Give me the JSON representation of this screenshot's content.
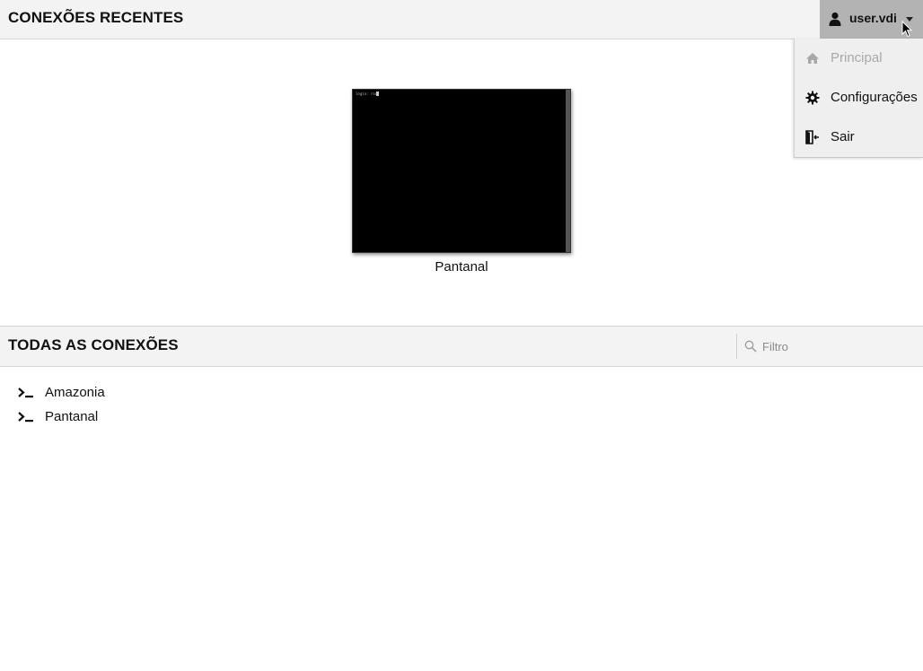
{
  "recent": {
    "title": "CONEXÕES RECENTES",
    "connections": [
      {
        "name": "Pantanal",
        "terminal_text": "login: root"
      }
    ]
  },
  "user_menu": {
    "username": "user.vdi",
    "icon": "user-icon",
    "items": [
      {
        "label": "Principal",
        "icon": "home-icon",
        "disabled": true
      },
      {
        "label": "Configurações",
        "icon": "gear-icon",
        "disabled": false
      },
      {
        "label": "Sair",
        "icon": "logout-icon",
        "disabled": false
      }
    ]
  },
  "all": {
    "title": "TODAS AS CONEXÕES",
    "filter": {
      "placeholder": "Filtro",
      "value": ""
    },
    "connections": [
      {
        "name": "Amazonia",
        "icon": "terminal-prompt-icon"
      },
      {
        "name": "Pantanal",
        "icon": "terminal-prompt-icon"
      }
    ]
  },
  "colors": {
    "header_bg": "#f3f3f3",
    "user_menu_bg": "#b3b3b3",
    "dropdown_bg": "#efefef",
    "disabled_text": "#a8a8a8"
  }
}
